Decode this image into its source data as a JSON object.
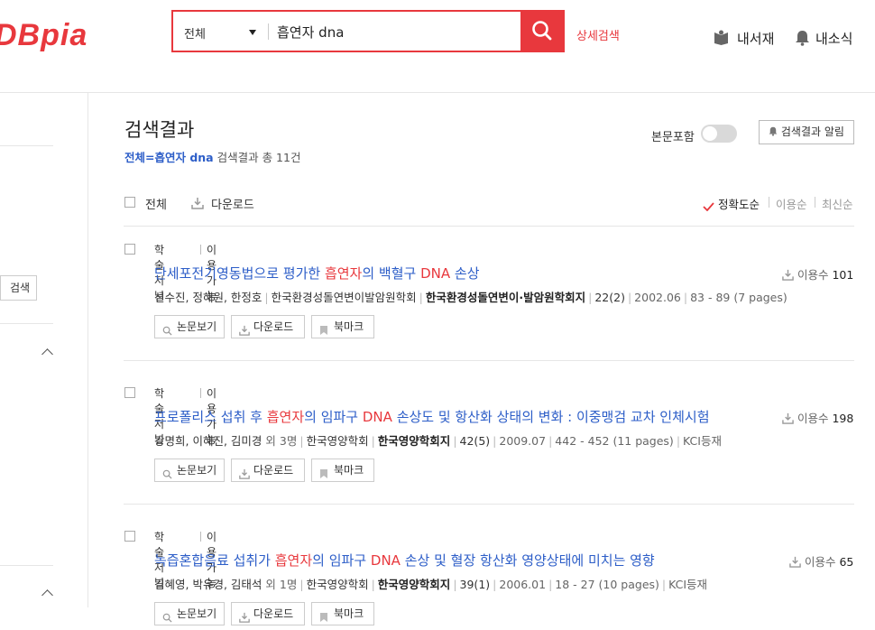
{
  "header": {
    "logo_main": "DBpia",
    "search": {
      "scope": "전체",
      "query": "흡연자 dna"
    },
    "detail_search": "상세검색",
    "my_library": "내서재",
    "my_news": "내소식"
  },
  "sidebar": {
    "search_button": "검색"
  },
  "results": {
    "title": "검색결과",
    "summary_query": "전체=흡연자 dna",
    "summary_text": "검색결과 총 11건",
    "fulltext_label": "본문포함",
    "alert_button": "검색결과 알림",
    "select_all": "전체",
    "download_all": "다운로드",
    "sort": {
      "accuracy": "정확도순",
      "popularity": "이용순",
      "latest": "최신순",
      "active": "accuracy"
    }
  },
  "items": [
    {
      "type": "학술저널",
      "access": "이용가능",
      "title_pre": "단세포전기영동법으로 평가한 ",
      "title_hl1": "흡연자",
      "title_mid": "의 백혈구 ",
      "title_hl2": "DNA",
      "title_post": " 손상",
      "authors": "선수진, 정해원, 한정호",
      "authors_extra": "",
      "publisher": "한국환경성돌연변이발암원학회",
      "journal": "한국환경성돌연변이·발암원학회지",
      "issue": "22(2)",
      "date": "2002.06",
      "pages": "83 - 89 (7 pages)",
      "kci": "",
      "usage_label": "이용수",
      "usage": "101",
      "buttons": {
        "view": "논문보기",
        "download": "다운로드",
        "bookmark": "북마크"
      }
    },
    {
      "type": "학술저널",
      "access": "이용가능",
      "title_pre": "프로폴리스 섭취 후 ",
      "title_hl1": "흡연자",
      "title_mid": "의 임파구 ",
      "title_hl2": "DNA",
      "title_post": " 손상도 및 항산화 상태의 변화 : 이중맹검 교차 인체시험",
      "authors": "강명희, 이혜진, 김미경",
      "authors_extra": "외 3명",
      "publisher": "한국영양학회",
      "journal": "한국영양학회지",
      "issue": "42(5)",
      "date": "2009.07",
      "pages": "442 - 452 (11 pages)",
      "kci": "KCI등재",
      "usage_label": "이용수",
      "usage": "198",
      "buttons": {
        "view": "논문보기",
        "download": "다운로드",
        "bookmark": "북마크"
      }
    },
    {
      "type": "학술저널",
      "access": "이용가능",
      "title_pre": "녹즙혼합음료 섭취가 ",
      "title_hl1": "흡연자",
      "title_mid": "의 임파구 ",
      "title_hl2": "DNA",
      "title_post": " 손상 및 혈장 항산화 영양상태에 미치는 영향",
      "authors": "김혜영, 박유경, 김태석",
      "authors_extra": "외 1명",
      "publisher": "한국영양학회",
      "journal": "한국영양학회지",
      "issue": "39(1)",
      "date": "2006.01",
      "pages": "18 - 27 (10 pages)",
      "kci": "KCI등재",
      "usage_label": "이용수",
      "usage": "65",
      "buttons": {
        "view": "논문보기",
        "download": "다운로드",
        "bookmark": "북마크"
      }
    }
  ],
  "colors": {
    "brand": "#e8383d",
    "link": "#2d5ec8"
  },
  "icons": [
    "search-icon",
    "book-icon",
    "bell-icon",
    "download-icon",
    "checkmark-icon",
    "magnifier-icon",
    "bookmark-icon",
    "chevron-up-icon"
  ]
}
